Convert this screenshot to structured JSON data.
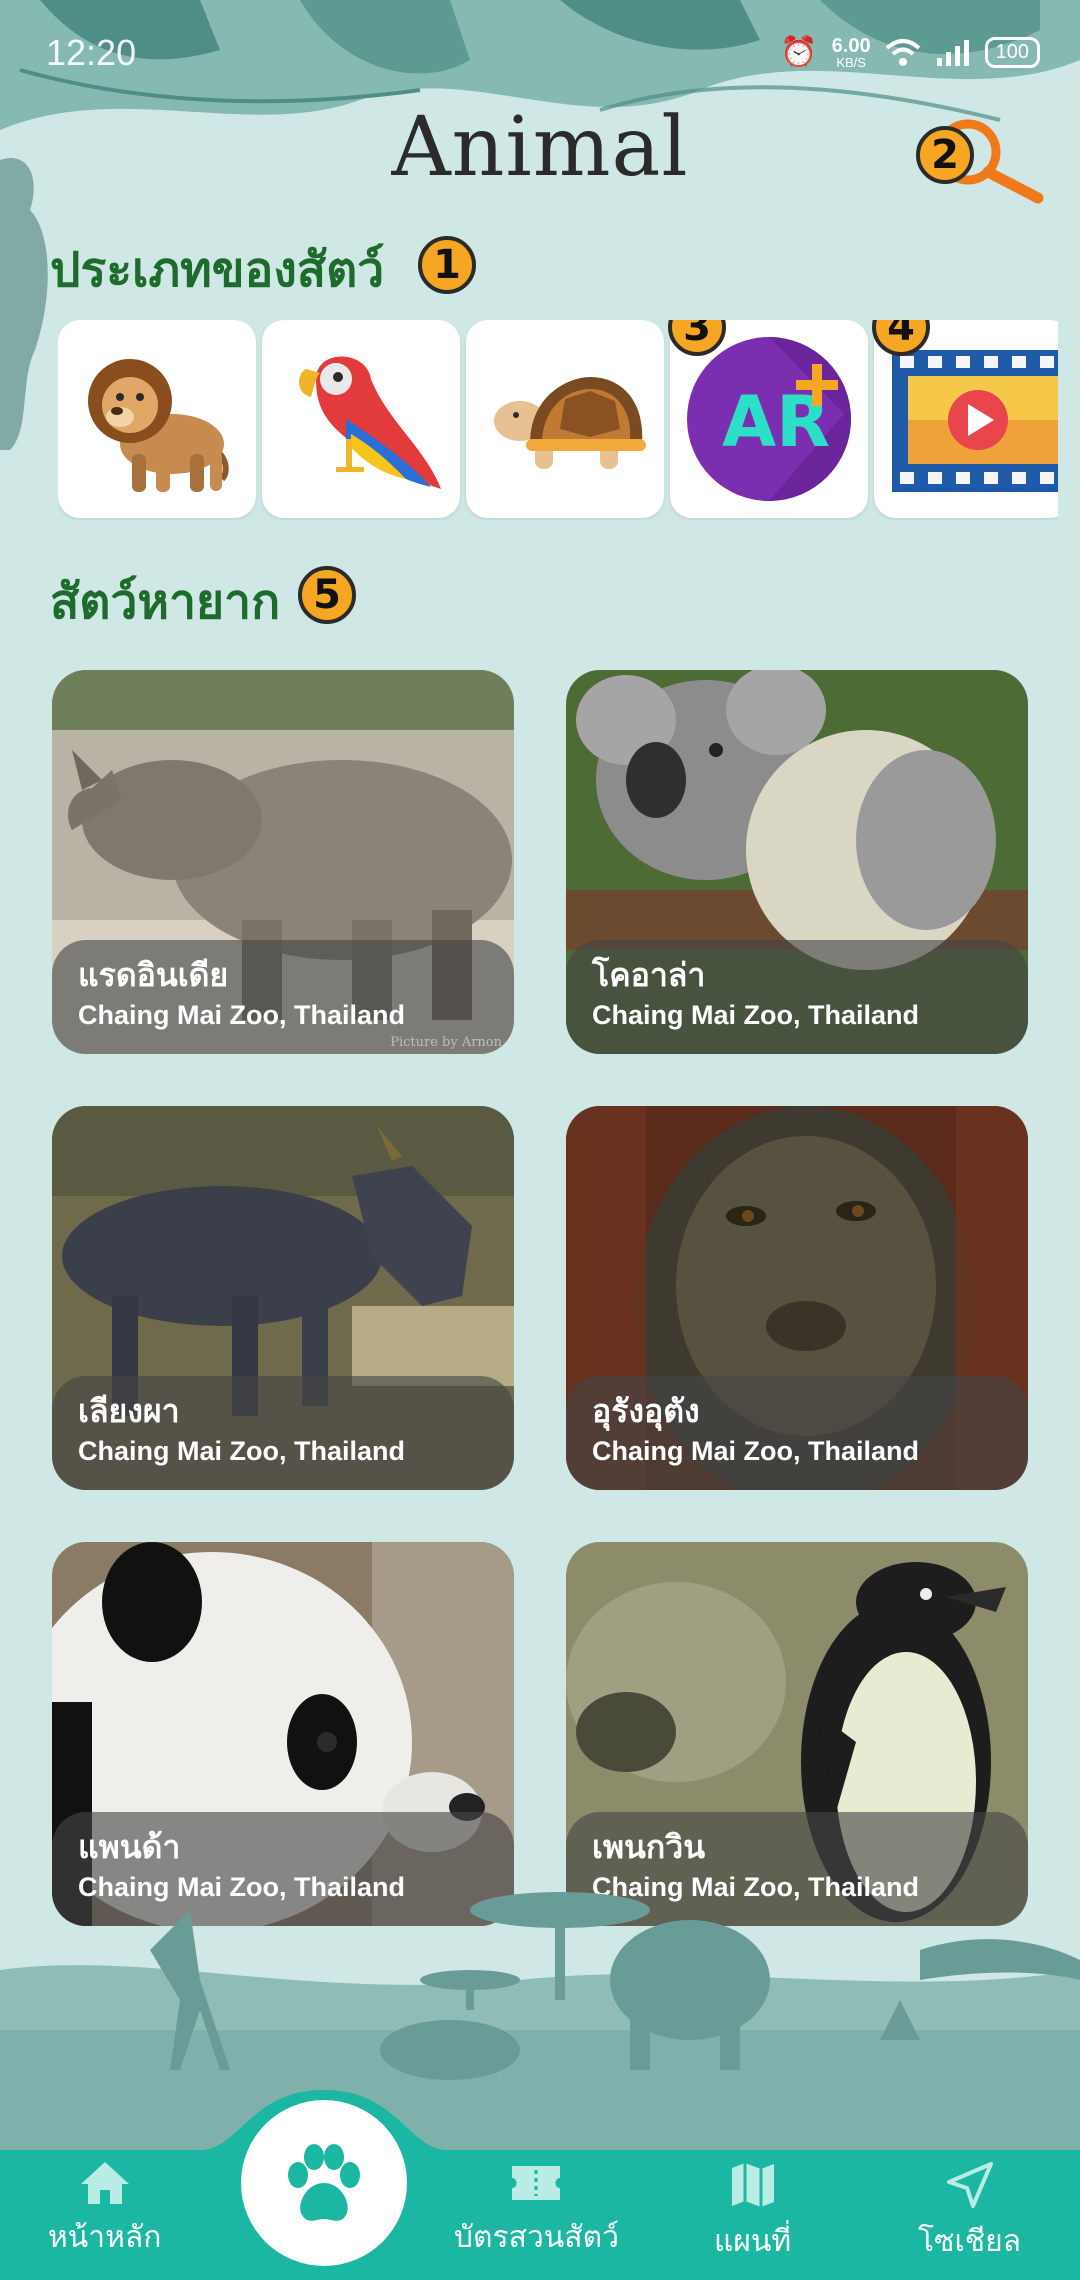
{
  "status_bar": {
    "time": "12:20",
    "net_speed_value": "6.00",
    "net_speed_unit": "KB/S",
    "battery": "100",
    "icons": [
      "alarm-icon",
      "wifi-icon",
      "signal-icon",
      "battery-icon"
    ]
  },
  "header": {
    "title": "Animal",
    "search_badge": "2"
  },
  "categories_section": {
    "title": "ประเภทของสัตว์",
    "badge": "1",
    "items": [
      {
        "icon": "lion-icon"
      },
      {
        "icon": "parrot-icon"
      },
      {
        "icon": "tortoise-icon"
      },
      {
        "icon": "ar-icon",
        "badge": "3",
        "icon_text": "AR"
      },
      {
        "icon": "video-icon",
        "badge": "4"
      }
    ]
  },
  "rare_section": {
    "title": "สัตว์หายาก",
    "badge": "5",
    "cards": [
      {
        "name": "แรดอินเดีย",
        "location": "Chaing Mai Zoo, Thailand",
        "credit": "Picture by Arnon"
      },
      {
        "name": "โคอาล่า",
        "location": "Chaing Mai Zoo, Thailand"
      },
      {
        "name": "เลียงผา",
        "location": "Chaing Mai Zoo, Thailand"
      },
      {
        "name": "อุรังอุตัง",
        "location": "Chaing Mai Zoo, Thailand"
      },
      {
        "name": "แพนด้า",
        "location": "Chaing Mai Zoo, Thailand"
      },
      {
        "name": "เพนกวิน",
        "location": "Chaing Mai Zoo, Thailand"
      }
    ]
  },
  "bottom_nav": {
    "items": [
      {
        "label": "หน้าหลัก",
        "icon": "home-icon"
      },
      {
        "label": "",
        "icon": "paw-icon",
        "active": true
      },
      {
        "label": "บัตรสวนสัตว์",
        "icon": "ticket-icon"
      },
      {
        "label": "แผนที่",
        "icon": "map-icon"
      },
      {
        "label": "โซเชียล",
        "icon": "send-icon"
      }
    ]
  },
  "colors": {
    "background": "#cfe7e5",
    "section_title": "#1e6b2d",
    "badge": "#f5a623",
    "nav_bar": "#1bb7a3",
    "search_icon": "#f07a1a"
  }
}
